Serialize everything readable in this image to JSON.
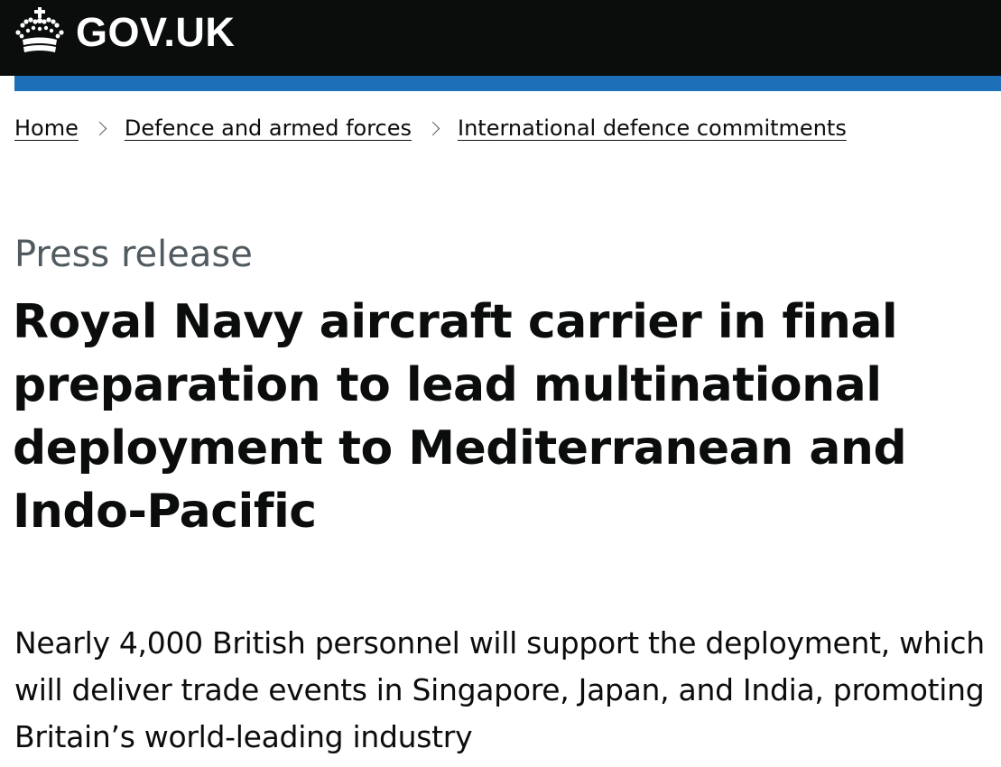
{
  "header": {
    "logo_text": "GOV.UK",
    "logo_icon": "crown-icon",
    "background_color": "#0b0c0c",
    "accent_color": "#1d70b8"
  },
  "breadcrumbs": [
    {
      "label": "Home"
    },
    {
      "label": "Defence and armed forces"
    },
    {
      "label": "International defence commitments"
    }
  ],
  "main": {
    "caption": "Press release",
    "title": "Royal Navy aircraft carrier in final preparation to lead multinational deployment to Mediterranean and Indo-Pacific",
    "lead": "Nearly 4,000 British personnel will support the deployment, which will deliver trade events in Singapore, Japan, and India, promoting Britain’s world-leading industry"
  }
}
